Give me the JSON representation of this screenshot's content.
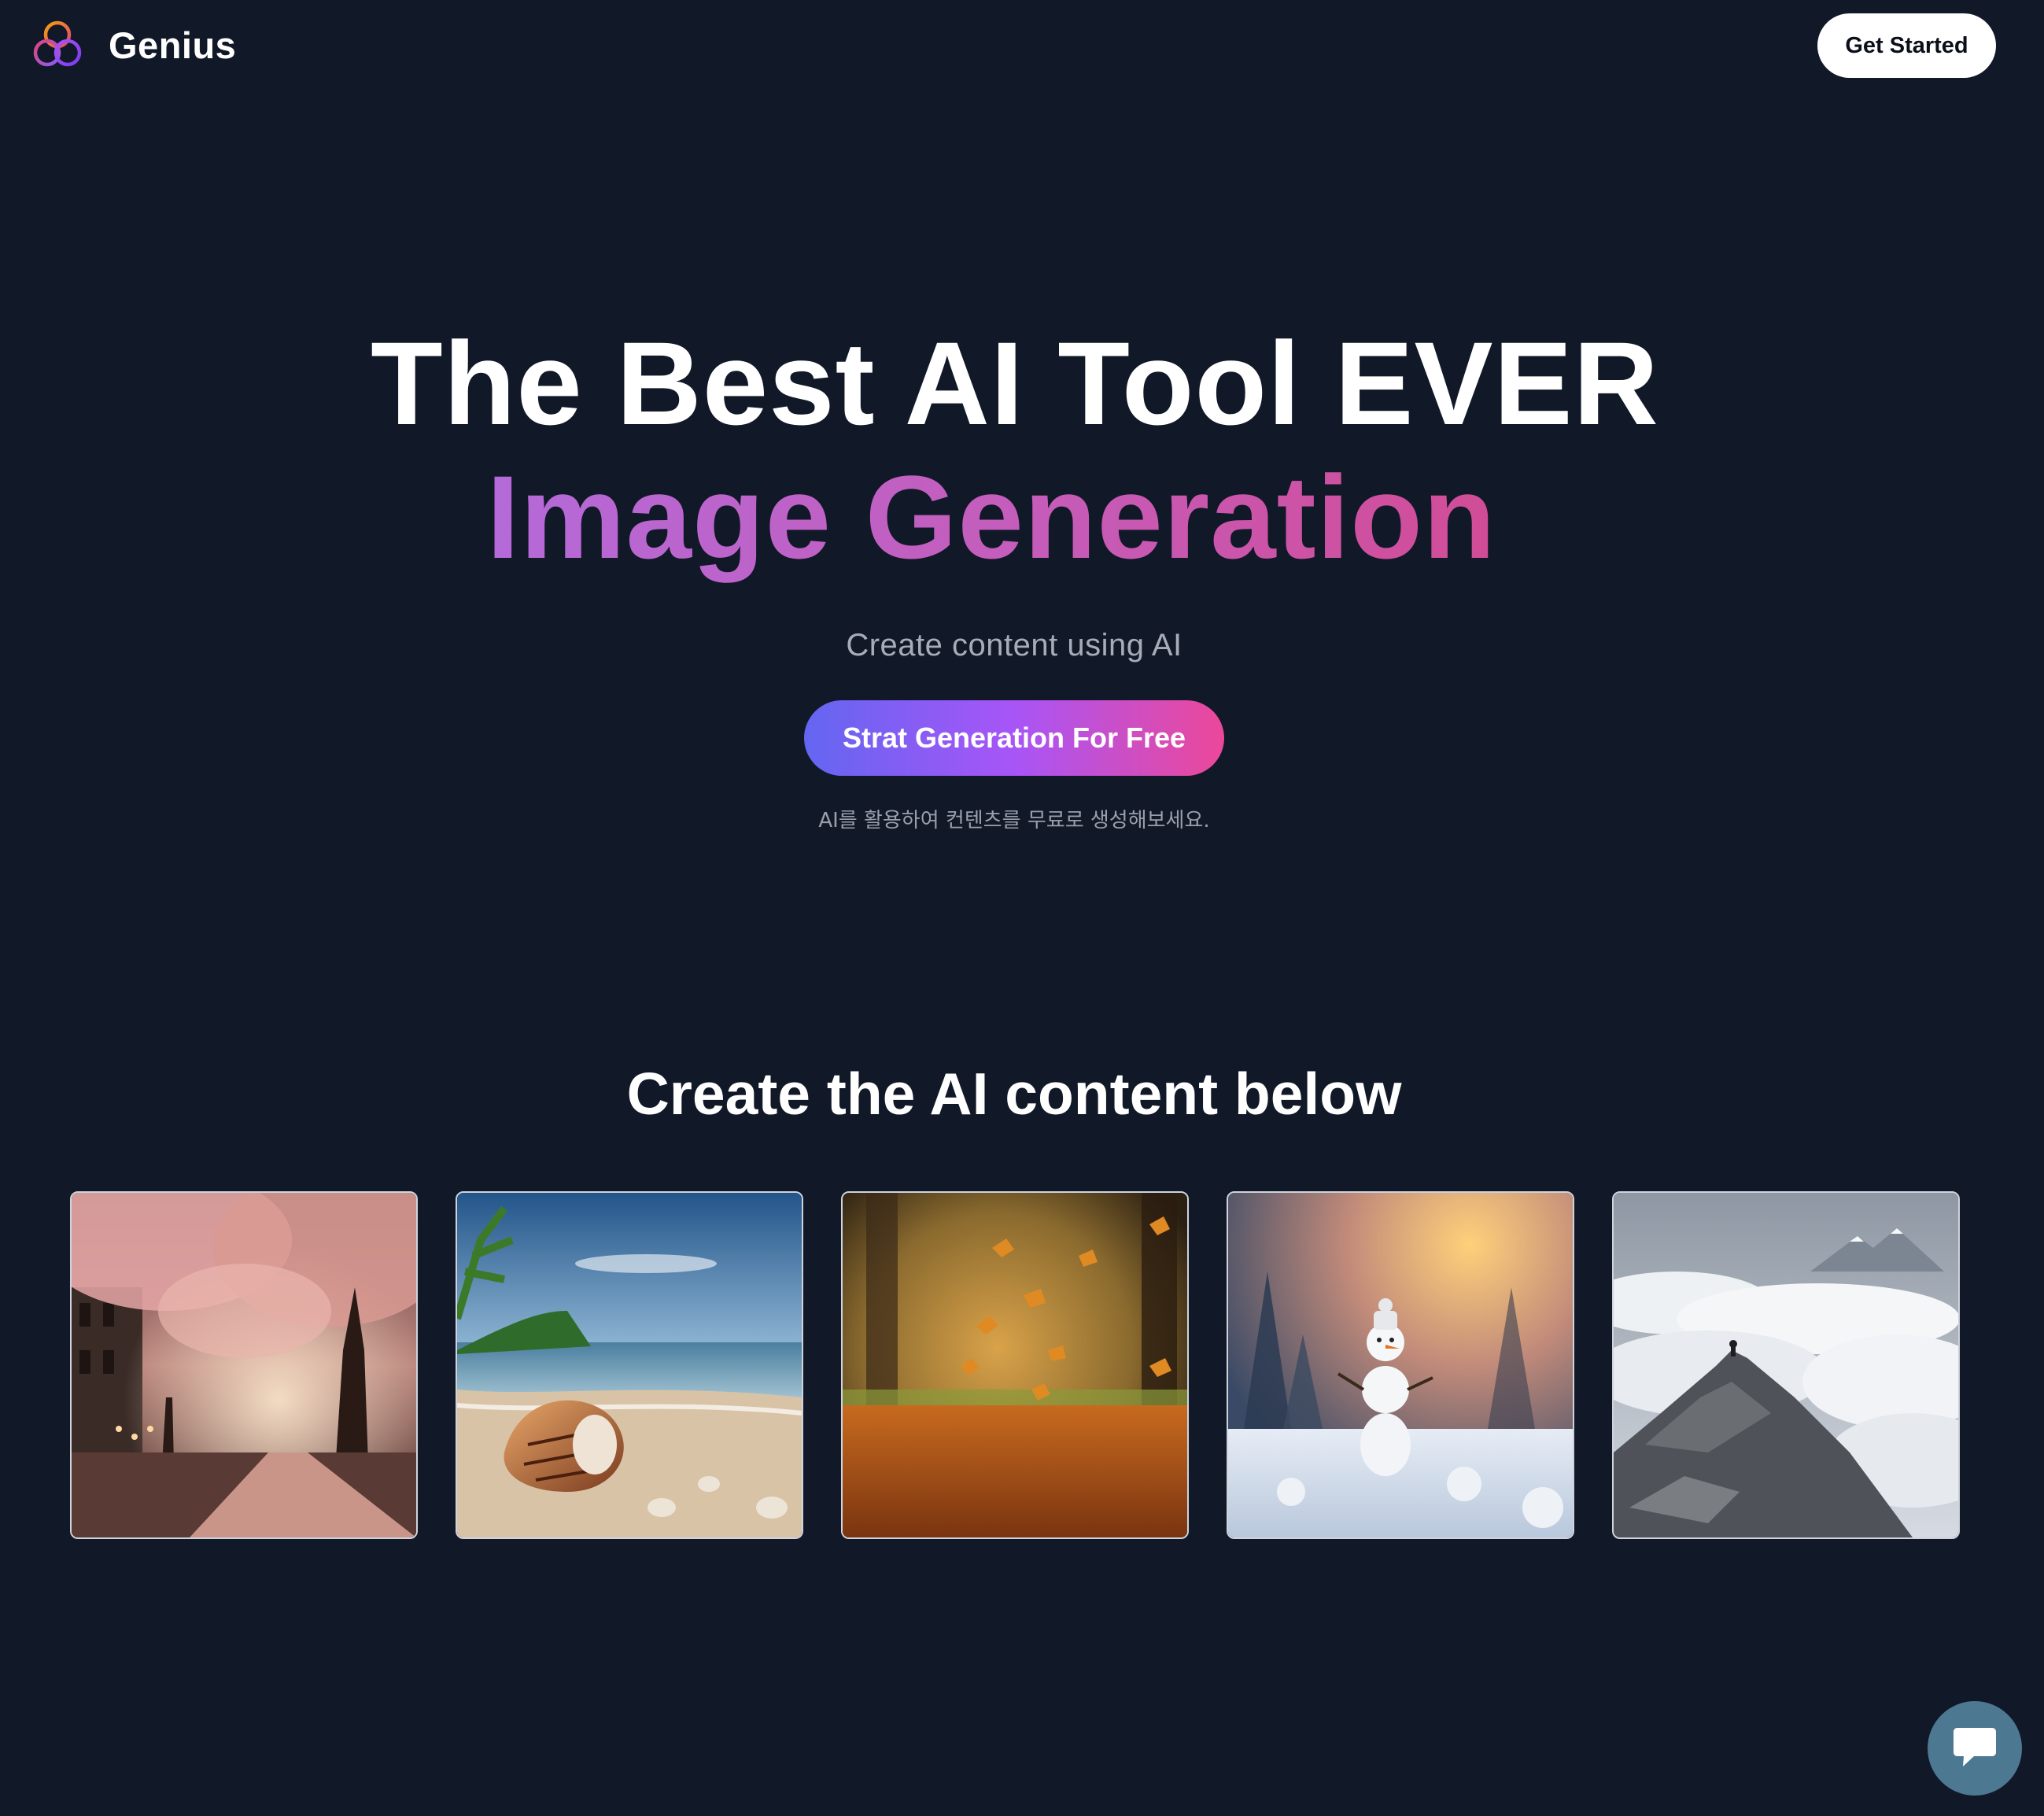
{
  "navbar": {
    "brand_name": "Genius",
    "logo_icon": "three-rings-logo-icon",
    "get_started_label": "Get Started"
  },
  "hero": {
    "title_line1": "The Best AI Tool EVER",
    "title_line2": "Image Generation",
    "subtitle": "Create content using AI",
    "cta_label": "Strat Generation For Free",
    "korean_note": "AI를 활용하여 컨텐츠를 무료로 생성해보세요."
  },
  "gallery": {
    "title": "Create the AI content below",
    "items": [
      {
        "name": "cherry-blossom-street-image"
      },
      {
        "name": "seashell-beach-image"
      },
      {
        "name": "autumn-leaves-image"
      },
      {
        "name": "snowman-winter-image"
      },
      {
        "name": "mountain-above-clouds-image"
      }
    ]
  },
  "chat": {
    "icon": "chat-bubble-icon"
  },
  "colors": {
    "background": "#111827",
    "gradient_start": "#6366f1",
    "gradient_mid": "#a855f7",
    "gradient_end": "#ec4899",
    "title_gradient_start": "#b46ad9",
    "title_gradient_end": "#d14c96",
    "chat_button": "#4d7892"
  }
}
